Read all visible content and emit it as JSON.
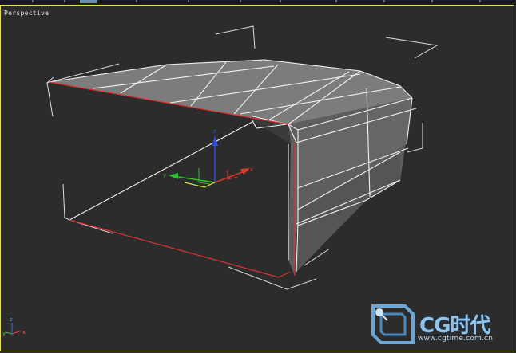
{
  "viewport": {
    "label": "Perspective",
    "border_color": "#e0e060",
    "background": "#2c2c2c"
  },
  "gizmo": {
    "x_label": "x",
    "y_label": "y",
    "z_label": "z",
    "x_color": "#d83a2a",
    "y_color": "#2fbf2f",
    "z_color": "#2a4fe0"
  },
  "view_axis_tripod": {
    "x_label": "x",
    "y_label": "y",
    "z_label": "z"
  },
  "watermark": {
    "brand": "CG时代",
    "url": "www.cgtime.com.cn",
    "color": "#8fc3ea"
  },
  "model": {
    "wire_color": "#ffffff",
    "selected_edge_color": "#e03030",
    "face_color": "#7a7a7a"
  }
}
